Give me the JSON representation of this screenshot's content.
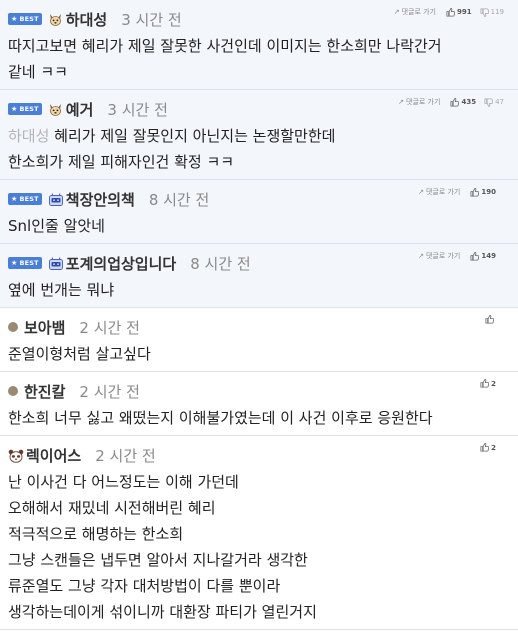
{
  "ui": {
    "best_label": "BEST",
    "reply_link_label": "댓글로 가기"
  },
  "comments": [
    {
      "best": true,
      "avatar": "dog-icon",
      "nick": "하대성",
      "time": "3 시간 전",
      "up": "991",
      "down": "119",
      "quote": "",
      "lines": [
        "따지고보면 혜리가 제일 잘못한 사건인데 이미지는 한소희만 나락간거",
        "같네 ㅋㅋ"
      ]
    },
    {
      "best": true,
      "avatar": "dog-icon",
      "nick": "예거",
      "time": "3 시간 전",
      "up": "435",
      "down": "47",
      "quote": "하대성",
      "lines": [
        "혜리가 제일 잘못인지 아닌지는 논쟁할만한데",
        "한소희가 제일 피해자인건 확정 ㅋㅋ"
      ]
    },
    {
      "best": true,
      "avatar": "robot-icon",
      "nick": "책장안의책",
      "time": "8 시간 전",
      "up": "190",
      "down": "",
      "quote": "",
      "lines": [
        "Snl인줄 알앗네"
      ]
    },
    {
      "best": true,
      "avatar": "robot-icon",
      "nick": "포계의업상입니다",
      "time": "8 시간 전",
      "up": "149",
      "down": "",
      "quote": "",
      "lines": [
        "옆에 번개는 뭐냐"
      ]
    },
    {
      "best": false,
      "avatar": "circle",
      "nick": "보아뱀",
      "time": "2 시간 전",
      "up": "",
      "down": "",
      "quote": "",
      "lines": [
        "준열이형처럼 살고싶다"
      ]
    },
    {
      "best": false,
      "avatar": "circle",
      "nick": "한진칼",
      "time": "2 시간 전",
      "up": "2",
      "down": "",
      "quote": "",
      "lines": [
        "한소희 너무 싫고 왜떴는지 이해불가였는데 이 사건 이후로 응원한다"
      ]
    },
    {
      "best": false,
      "avatar": "panda-icon",
      "nick": "렉이어스",
      "time": "2 시간 전",
      "up": "2",
      "down": "",
      "quote": "",
      "lines": [
        "난 이사건 다 어느정도는 이해 가던데",
        "오해해서 재밌네 시전해버린 혜리",
        "적극적으로 해명하는 한소희",
        "그냥 스캔들은 냅두면 알아서 지나갈거라 생각한",
        "류준열도 그냥 각자 대처방법이 다를 뿐이라",
        "생각하는데이게 섞이니까 대환장 파티가 열린거지"
      ]
    }
  ]
}
